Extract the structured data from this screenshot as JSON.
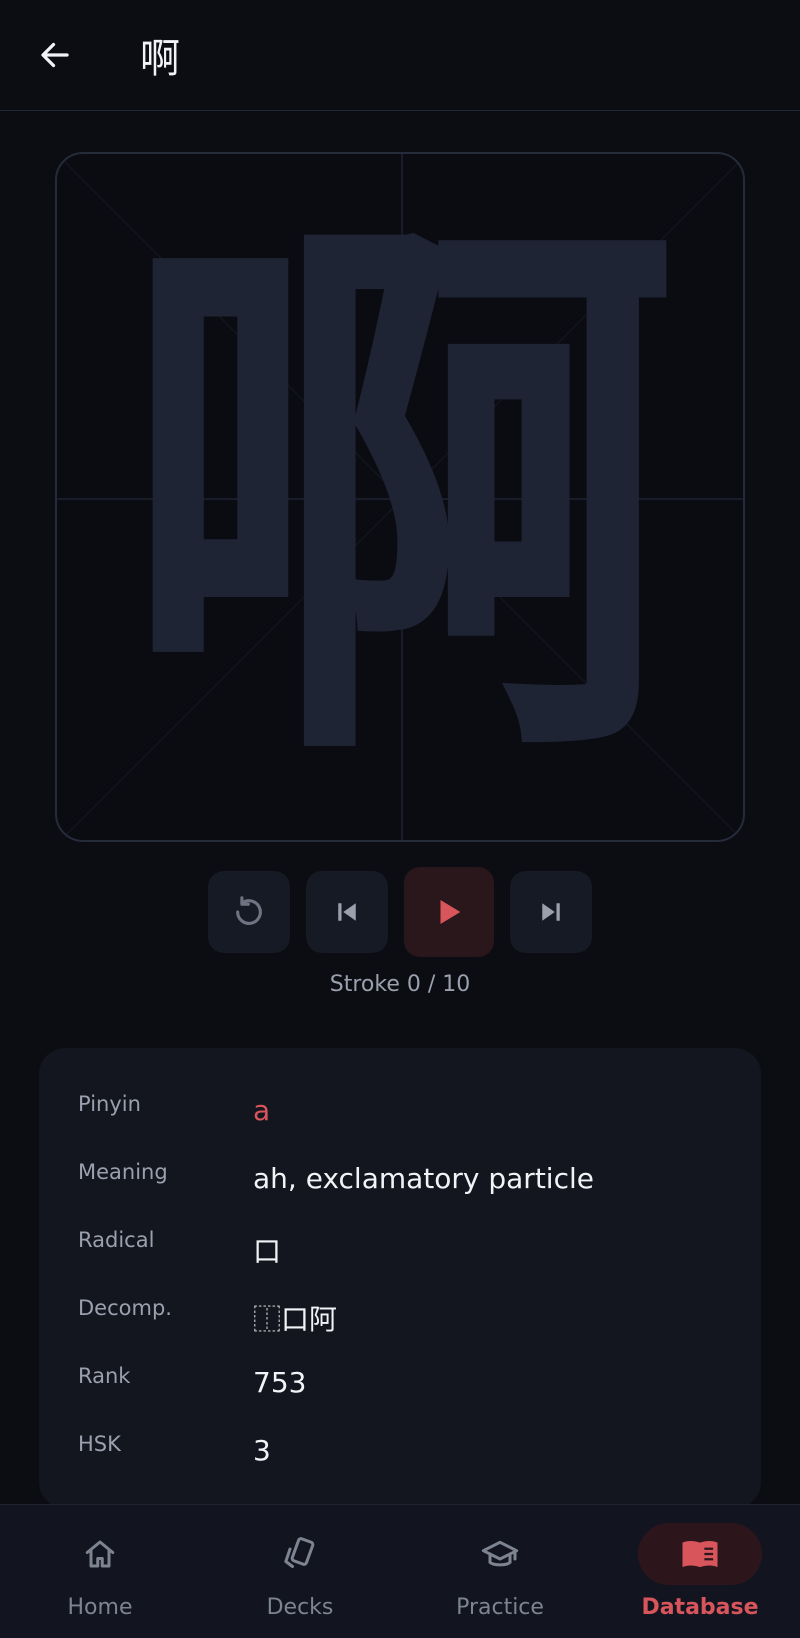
{
  "header": {
    "title": "啊"
  },
  "canvas": {
    "character": "啊"
  },
  "controls": {
    "stroke_label": "Stroke 0 / 10"
  },
  "info": {
    "rows": [
      {
        "label": "Pinyin",
        "value": "a"
      },
      {
        "label": "Meaning",
        "value": "ah, exclamatory particle"
      },
      {
        "label": "Radical",
        "value": "口"
      },
      {
        "label": "Decomp.",
        "value": "⿰口阿"
      },
      {
        "label": "Rank",
        "value": "753"
      },
      {
        "label": "HSK",
        "value": "3"
      }
    ]
  },
  "nav": {
    "items": [
      {
        "label": "Home",
        "icon": "home-icon"
      },
      {
        "label": "Decks",
        "icon": "cards-icon"
      },
      {
        "label": "Practice",
        "icon": "graduation-cap-icon"
      },
      {
        "label": "Database",
        "icon": "book-icon"
      }
    ],
    "active": "Database"
  },
  "colors": {
    "accent": "#d9555c",
    "background": "#0b0d12",
    "card": "#13161f",
    "character_fill": "#1f2435"
  }
}
